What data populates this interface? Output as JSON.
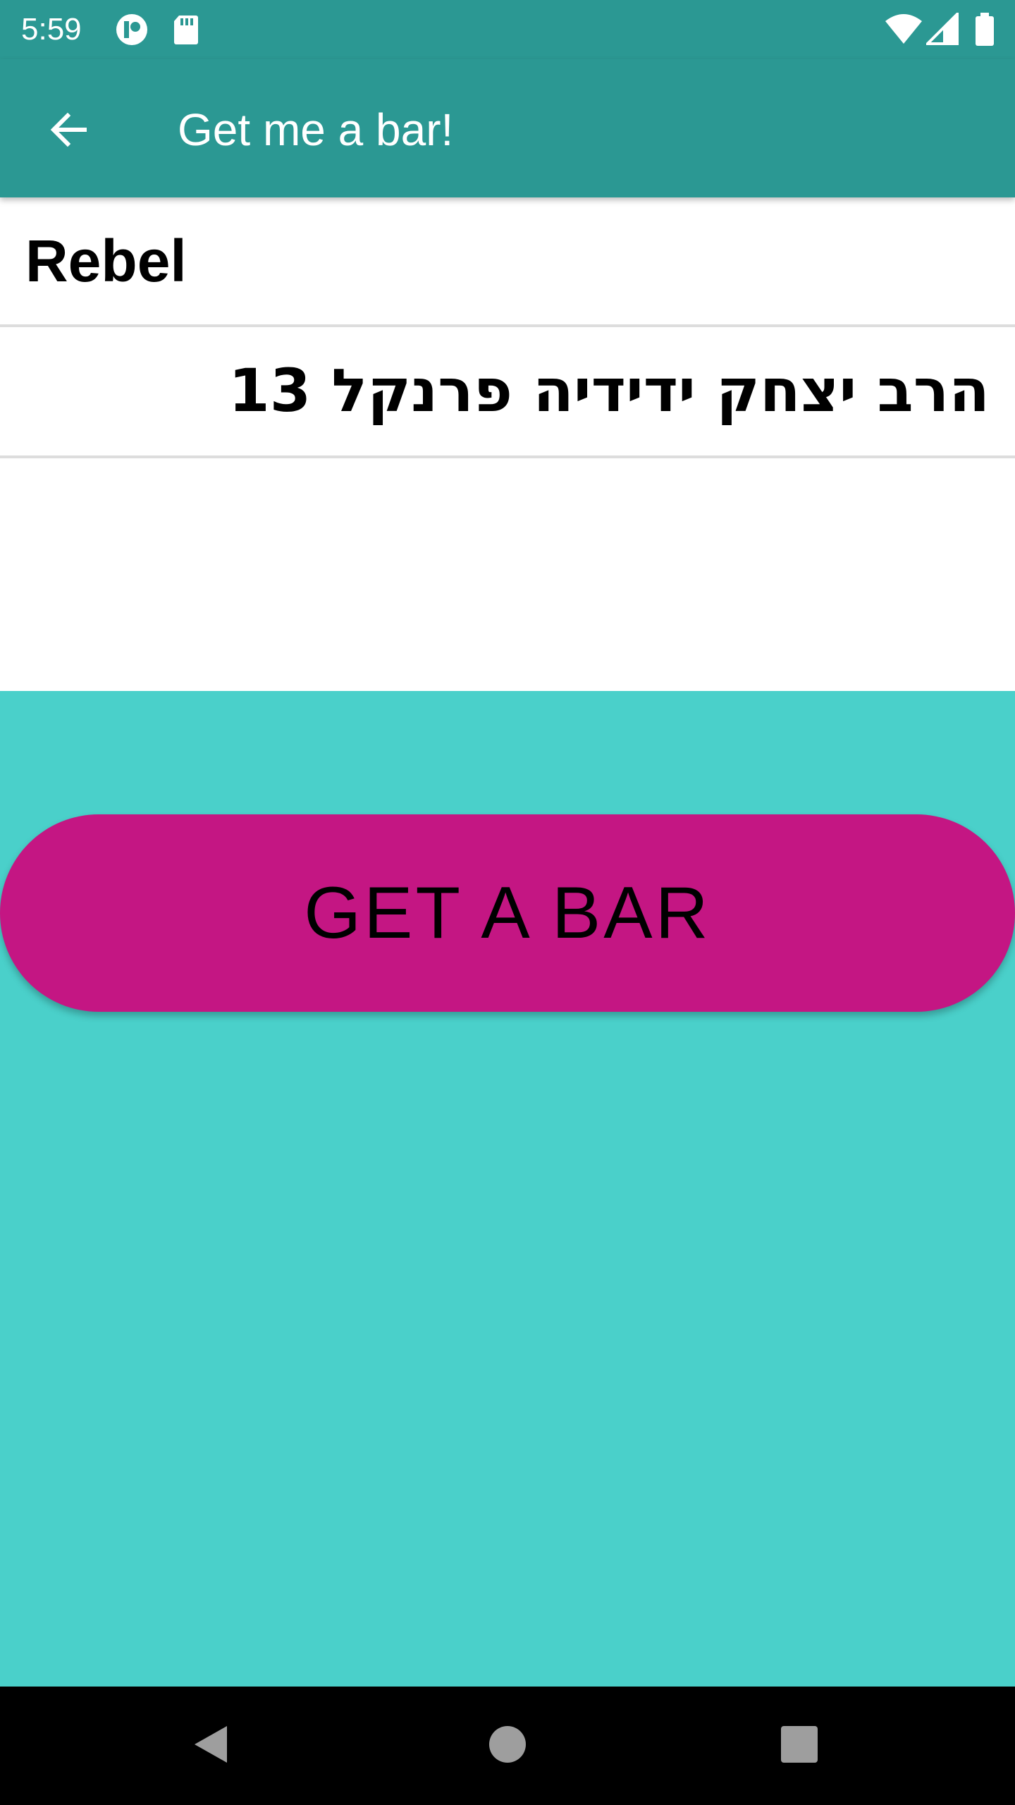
{
  "status_bar": {
    "time": "5:59",
    "icons": [
      "notification-app-icon",
      "sd-card-icon",
      "wifi-icon",
      "cellular-signal-icon",
      "battery-icon"
    ]
  },
  "app_bar": {
    "title": "Get me a bar!",
    "back_icon": "arrow-back-icon"
  },
  "bar_info": {
    "name": "Rebel",
    "address": "הרב יצחק ידידיה פרנקל 13"
  },
  "action_button": {
    "label": "GET A BAR"
  },
  "nav_bar": {
    "buttons": [
      "back-triangle-icon",
      "home-circle-icon",
      "recents-square-icon"
    ]
  },
  "colors": {
    "primary": "#2b9893",
    "background": "#4ad0ca",
    "accent": "#c41683",
    "panel": "#ffffff"
  }
}
